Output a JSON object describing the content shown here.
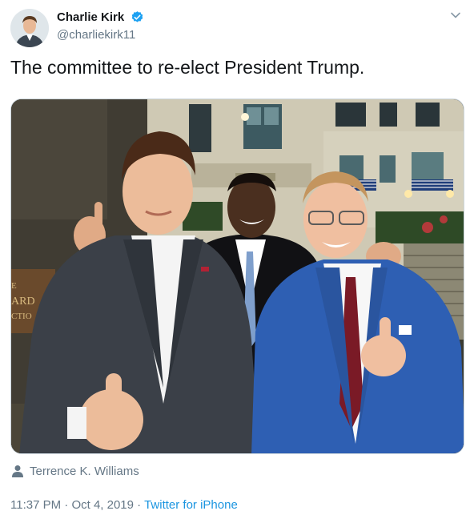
{
  "author": {
    "display_name": "Charlie Kirk",
    "handle": "@charliekirk11",
    "verified": true,
    "verified_color": "#1da1f2"
  },
  "tweet": {
    "text": "The committee to re-elect President Trump."
  },
  "media": {
    "tagged_user": "Terrence K. Williams",
    "tag_icon": "person-icon",
    "sign_letters": [
      "E",
      "ARD",
      "CTIO"
    ]
  },
  "meta": {
    "time": "11:37 PM",
    "separator": "·",
    "date": "Oct 4, 2019",
    "source": "Twitter for iPhone",
    "link_color": "#1b95e0"
  },
  "menu": {
    "icon": "chevron-down-icon"
  }
}
